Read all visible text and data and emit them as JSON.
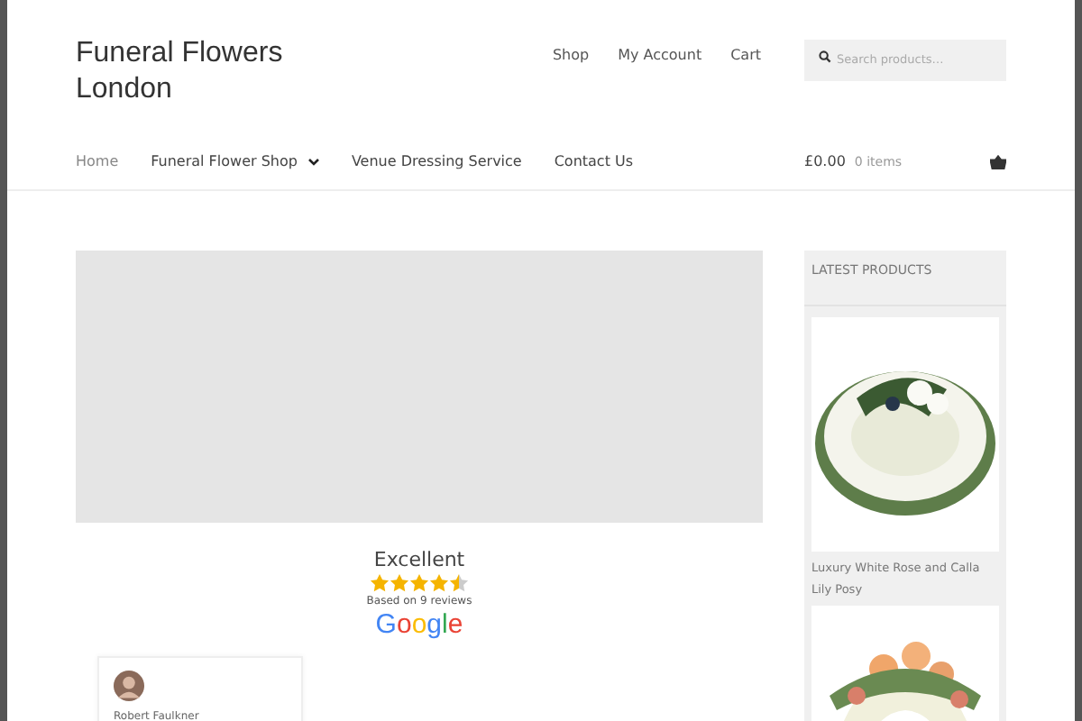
{
  "site_title": "Funeral Flowers London",
  "top_nav": [
    {
      "label": "Shop"
    },
    {
      "label": "My Account"
    },
    {
      "label": "Cart"
    }
  ],
  "search": {
    "placeholder": "Search products…"
  },
  "main_nav": [
    {
      "label": "Home",
      "selected": true,
      "has_dropdown": false
    },
    {
      "label": "Funeral Flower Shop",
      "selected": false,
      "has_dropdown": true
    },
    {
      "label": "Venue Dressing Service",
      "selected": false,
      "has_dropdown": false
    },
    {
      "label": "Contact Us",
      "selected": false,
      "has_dropdown": false
    }
  ],
  "cart": {
    "total": "£0.00",
    "count": "0 items"
  },
  "reviews": {
    "rating": "Excellent",
    "stars": 4.5,
    "summary": "Based on 9 reviews",
    "source": "Google",
    "review_card": {
      "author": "Robert Faulkner"
    }
  },
  "sidebar": {
    "title": "LATEST PRODUCTS",
    "products": [
      {
        "name": "Luxury White Rose and Calla Lily Posy",
        "image": {
          "kind": "picture"
        }
      },
      {
        "image": {
          "kind": "picture"
        }
      }
    ]
  }
}
